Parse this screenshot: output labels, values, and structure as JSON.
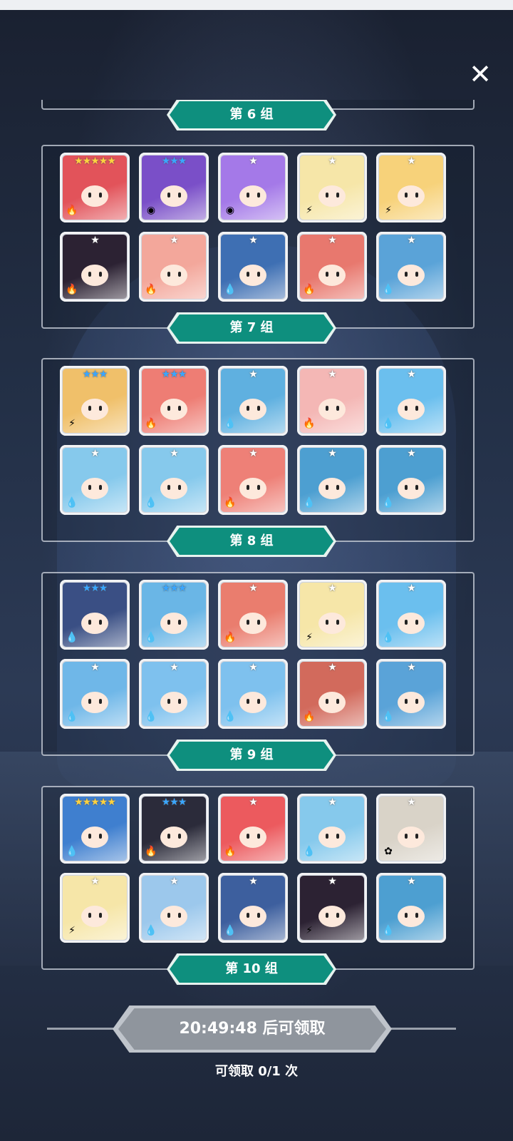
{
  "close_icon": "close-icon",
  "groups": [
    {
      "label": "第 6 组"
    },
    {
      "label": "第 7 组"
    },
    {
      "label": "第 8 组"
    },
    {
      "label": "第 9 组"
    },
    {
      "label": "第 10 组"
    }
  ],
  "rosters": [
    [
      {
        "stars": "★★★★★",
        "star_color": "#ffd23f",
        "element": "fire",
        "color": "#e2535a"
      },
      {
        "stars": "★★★",
        "star_color": "#3aa6ff",
        "element": "dark",
        "color": "#7a4fc8"
      },
      {
        "stars": "★",
        "star_color": "#ffffff",
        "element": "dark",
        "color": "#a479e8"
      },
      {
        "stars": "★",
        "star_color": "#ffffff",
        "element": "light",
        "color": "#f6e6a8"
      },
      {
        "stars": "★",
        "star_color": "#ffffff",
        "element": "light",
        "color": "#f7d27a"
      },
      {
        "stars": "★",
        "star_color": "#ffffff",
        "element": "fire",
        "color": "#2c2233"
      },
      {
        "stars": "★",
        "star_color": "#ffffff",
        "element": "fire",
        "color": "#f3a79b"
      },
      {
        "stars": "★",
        "star_color": "#ffffff",
        "element": "water",
        "color": "#3e6fb3"
      },
      {
        "stars": "★",
        "star_color": "#ffffff",
        "element": "fire",
        "color": "#e8786e"
      },
      {
        "stars": "★",
        "star_color": "#ffffff",
        "element": "water",
        "color": "#5aa3d8"
      }
    ],
    [
      {
        "stars": "★★★",
        "star_color": "#3aa6ff",
        "element": "light",
        "color": "#f0c06a"
      },
      {
        "stars": "★★★",
        "star_color": "#3aa6ff",
        "element": "fire",
        "color": "#ee7d74"
      },
      {
        "stars": "★",
        "star_color": "#ffffff",
        "element": "water",
        "color": "#5fb0e0"
      },
      {
        "stars": "★",
        "star_color": "#ffffff",
        "element": "fire",
        "color": "#f4b7b5"
      },
      {
        "stars": "★",
        "star_color": "#ffffff",
        "element": "water",
        "color": "#6bbfee"
      },
      {
        "stars": "★",
        "star_color": "#ffffff",
        "element": "water",
        "color": "#86c9ec"
      },
      {
        "stars": "★",
        "star_color": "#ffffff",
        "element": "water",
        "color": "#86c9ec"
      },
      {
        "stars": "★",
        "star_color": "#ffffff",
        "element": "fire",
        "color": "#ee8077"
      },
      {
        "stars": "★",
        "star_color": "#ffffff",
        "element": "water",
        "color": "#4d9fd1"
      },
      {
        "stars": "★",
        "star_color": "#ffffff",
        "element": "water",
        "color": "#4d9fd1"
      }
    ],
    [
      {
        "stars": "★★★",
        "star_color": "#3aa6ff",
        "element": "water",
        "color": "#3a4f84"
      },
      {
        "stars": "★★★",
        "star_color": "#3aa6ff",
        "element": "water",
        "color": "#6ab6e6"
      },
      {
        "stars": "★",
        "star_color": "#ffffff",
        "element": "fire",
        "color": "#ea7d6e"
      },
      {
        "stars": "★",
        "star_color": "#ffffff",
        "element": "light",
        "color": "#f6e6a8"
      },
      {
        "stars": "★",
        "star_color": "#ffffff",
        "element": "water",
        "color": "#6bbfee"
      },
      {
        "stars": "★",
        "star_color": "#ffffff",
        "element": "water",
        "color": "#6fb7e8"
      },
      {
        "stars": "★",
        "star_color": "#ffffff",
        "element": "water",
        "color": "#7ec1ee"
      },
      {
        "stars": "★",
        "star_color": "#ffffff",
        "element": "water",
        "color": "#7ec1ee"
      },
      {
        "stars": "★",
        "star_color": "#ffffff",
        "element": "fire",
        "color": "#d26a5c"
      },
      {
        "stars": "★",
        "star_color": "#ffffff",
        "element": "water",
        "color": "#5aa3d8"
      }
    ],
    [
      {
        "stars": "★★★★★",
        "star_color": "#ffd23f",
        "element": "water",
        "color": "#3f7fcf"
      },
      {
        "stars": "★★★",
        "star_color": "#3aa6ff",
        "element": "fire",
        "color": "#2b2b3a"
      },
      {
        "stars": "★",
        "star_color": "#ffffff",
        "element": "fire",
        "color": "#ec5a5e"
      },
      {
        "stars": "★",
        "star_color": "#ffffff",
        "element": "water",
        "color": "#86c9ec"
      },
      {
        "stars": "★",
        "star_color": "#ffffff",
        "element": "wind",
        "color": "#d9d3c8"
      },
      {
        "stars": "★",
        "star_color": "#ffffff",
        "element": "light",
        "color": "#f6e6a8"
      },
      {
        "stars": "★",
        "star_color": "#ffffff",
        "element": "water",
        "color": "#9cc8ec"
      },
      {
        "stars": "★",
        "star_color": "#ffffff",
        "element": "water",
        "color": "#3d5f9e"
      },
      {
        "stars": "★",
        "star_color": "#ffffff",
        "element": "light",
        "color": "#2c2233"
      },
      {
        "stars": "★",
        "star_color": "#ffffff",
        "element": "water",
        "color": "#4d9fd1"
      }
    ]
  ],
  "element_icons": {
    "fire": "🔥",
    "water": "💧",
    "light": "⚡",
    "dark": "◉",
    "wind": "✿"
  },
  "claim": {
    "button_label": "20:49:48 后可领取",
    "count_text": "可领取 0/1 次"
  }
}
